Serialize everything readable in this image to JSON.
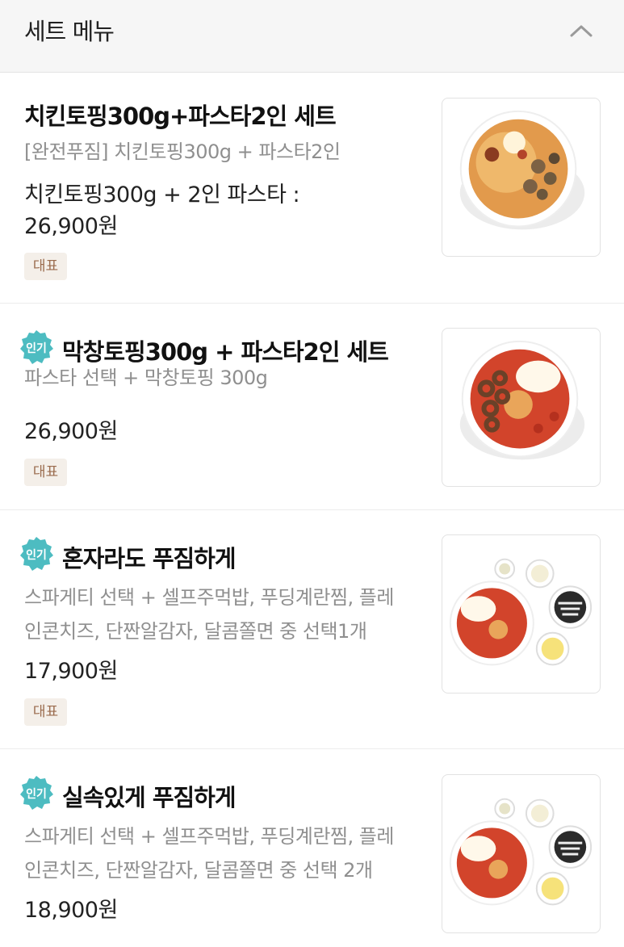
{
  "section": {
    "title": "세트 메뉴",
    "toggle_icon": "chevron-up-icon"
  },
  "items": [
    {
      "title": "치킨토핑300g+파스타2인 세트",
      "popular": false,
      "desc_lines": [
        "[완전푸짐] 치킨토핑300g + 파스타2인"
      ],
      "price_lines": [
        "치킨토핑300g + 2인 파스타 :",
        "26,900원"
      ],
      "tag": "대표",
      "image": "chicken-pasta-bowl"
    },
    {
      "title": "막창토핑300g + 파스타2인 세트",
      "popular": true,
      "badge": "인기",
      "desc_lines": [
        "파스타 선택 + 막창토핑 300g"
      ],
      "price_lines": [
        "26,900원"
      ],
      "tag": "대표",
      "image": "makchang-pasta-bowl"
    },
    {
      "title": "혼자라도 푸짐하게",
      "popular": true,
      "badge": "인기",
      "desc_lines": [
        "스파게티 선택 + 셀프주먹밥, 푸딩계란찜, 플레",
        "인콘치즈, 단짠알감자, 달콤쫄면 중 선택1개"
      ],
      "price_lines": [
        "17,900원"
      ],
      "tag": "대표",
      "image": "solo-set-dishes"
    },
    {
      "title": "실속있게 푸짐하게",
      "popular": true,
      "badge": "인기",
      "desc_lines": [
        "스파게티 선택 + 셀프주먹밥, 푸딩계란찜, 플레",
        "인콘치즈, 단짠알감자, 달콤쫄면 중 선택 2개"
      ],
      "price_lines": [
        "18,900원"
      ],
      "image": "value-set-dishes"
    }
  ],
  "colors": {
    "badge": "#4dbcc1",
    "tag_bg": "#f4efe9",
    "tag_text": "#9a6b4d",
    "header_bg": "#f6f6f6"
  }
}
